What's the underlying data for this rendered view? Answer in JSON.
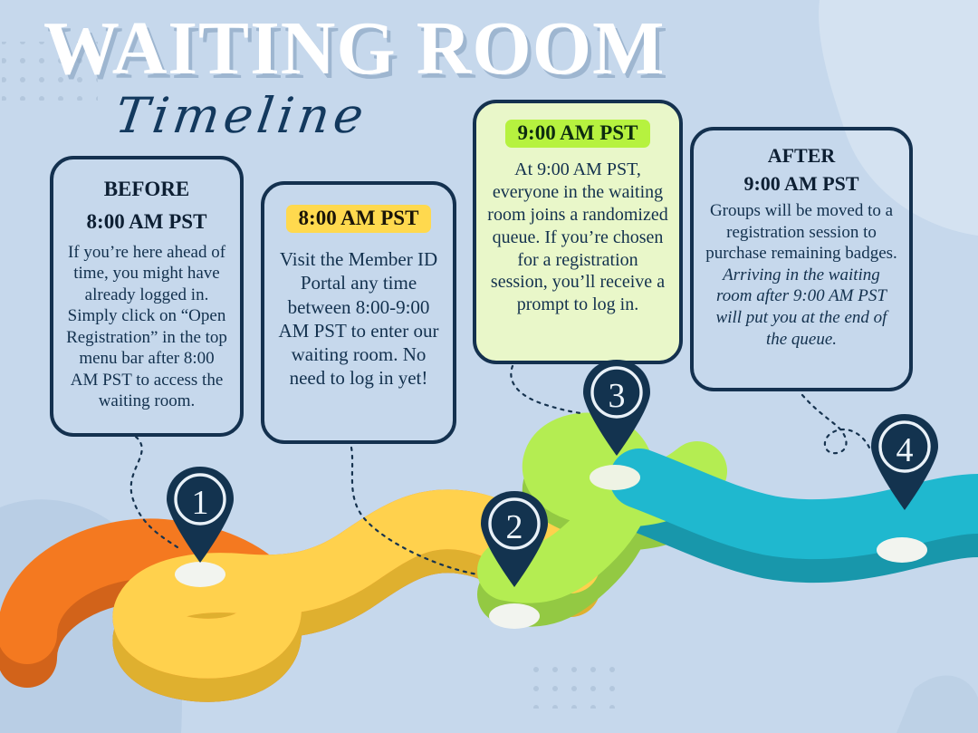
{
  "page": {
    "title_main": "WAITING ROOM",
    "title_sub": "Timeline",
    "background_color": "#c6d8ec",
    "ink_color": "#14314f"
  },
  "cards": [
    {
      "id": "card1",
      "step": "1",
      "title_line1": "BEFORE",
      "title_line2": "8:00 AM PST",
      "highlight": false,
      "body": "If you’re here ahead of time, you might have already logged in. Simply click on “Open Registration” in the top menu bar after 8:00 AM PST to access the waiting room.",
      "body_italic": ""
    },
    {
      "id": "card2",
      "step": "2",
      "title_line1": "8:00 AM PST",
      "title_line2": "",
      "highlight": true,
      "highlight_color": "#ffd94e",
      "body": "Visit the Member ID Portal any time between 8:00-9:00 AM PST to enter our waiting room. No need to log in yet!",
      "body_italic": ""
    },
    {
      "id": "card3",
      "step": "3",
      "title_line1": "9:00 AM PST",
      "title_line2": "",
      "highlight": true,
      "highlight_color": "#b6f23f",
      "card_fill": "#e9f7c9",
      "body": "At 9:00 AM PST, everyone in the waiting room joins a randomized queue. If you’re chosen for a registration session, you’ll receive a prompt to log in.",
      "body_italic": ""
    },
    {
      "id": "card4",
      "step": "4",
      "title_line1": "AFTER",
      "title_line2": "9:00 AM PST",
      "highlight": false,
      "body": "Groups will be moved to a registration session to purchase remaining badges.",
      "body_italic": "Arriving in the waiting room after 9:00 AM PST will put you at the end of the queue."
    }
  ],
  "pins": [
    {
      "number": "1",
      "color": "#13334f"
    },
    {
      "number": "2",
      "color": "#13334f"
    },
    {
      "number": "3",
      "color": "#13334f"
    },
    {
      "number": "4",
      "color": "#13334f"
    }
  ],
  "road": {
    "segments": [
      {
        "name": "segment-orange",
        "top": "#f47920",
        "side": "#d2631a"
      },
      {
        "name": "segment-yellow",
        "top": "#ffd14d",
        "side": "#dfb02f"
      },
      {
        "name": "segment-green",
        "top": "#b4ed52",
        "side": "#93c943"
      },
      {
        "name": "segment-teal",
        "top": "#1fb8cf",
        "side": "#1897ab"
      }
    ]
  }
}
